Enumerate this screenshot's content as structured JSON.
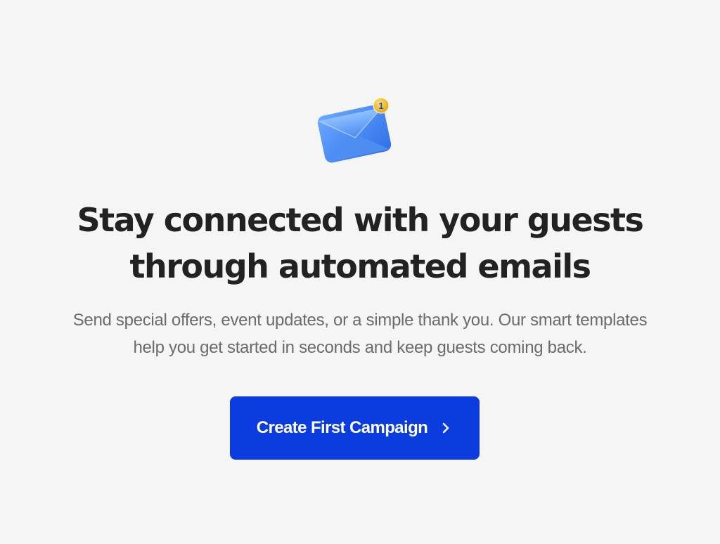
{
  "hero": {
    "icon": "envelope-notification-icon",
    "badge_count": "1",
    "colors": {
      "envelope": "#3b82f6",
      "badge": "#f5b400"
    }
  },
  "headline": {
    "line1": "Stay connected with your guests",
    "line2": "through automated emails"
  },
  "description": {
    "line1": "Send special offers, event updates, or a simple thank you. Our smart templates",
    "line2": "help you get started in seconds and keep guests coming back."
  },
  "cta": {
    "label": "Create First Campaign",
    "icon": "chevron-right-icon",
    "color": "#0a3ce0"
  }
}
